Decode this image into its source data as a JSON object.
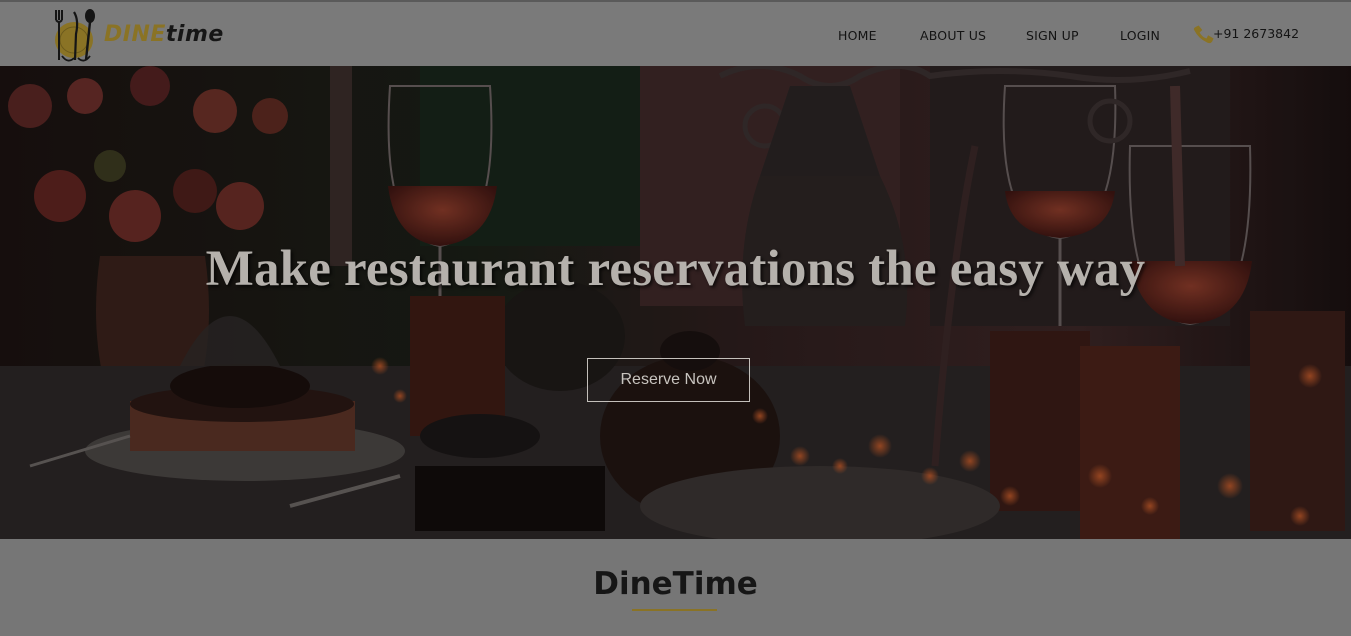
{
  "brand": {
    "part1": "DINE",
    "part2": "time"
  },
  "nav": {
    "home": "HOME",
    "about": "ABOUT US",
    "signup": "SIGN UP",
    "login": "LOGIN"
  },
  "contact": {
    "phone": "+91 2673842",
    "icon": "phone-icon"
  },
  "hero": {
    "title": "Make restaurant reservations the easy way",
    "button": "Reserve Now"
  },
  "section": {
    "title": "DineTime"
  },
  "colors": {
    "accent": "#8a7325",
    "overlay": "#767676"
  }
}
